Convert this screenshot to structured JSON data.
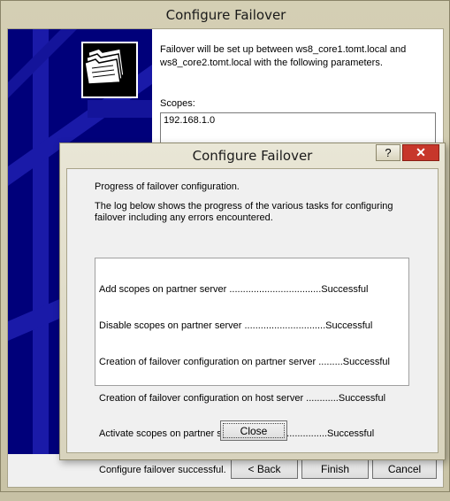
{
  "wizard": {
    "title": "Configure Failover",
    "description": "Failover will be set up between ws8_core1.tomt.local and ws8_core2.tomt.local with the following parameters.",
    "scopes_label": "Scopes:",
    "scopes": [
      "192.168.1.0"
    ],
    "buttons": {
      "back": "< Back",
      "finish": "Finish",
      "cancel": "Cancel"
    },
    "icon": "folders-icon"
  },
  "dialog": {
    "title": "Configure Failover",
    "help_glyph": "?",
    "close_glyph": "✕",
    "heading": "Progress of failover configuration.",
    "log_description": "The log below shows the progress of the various tasks for configuring failover including any errors encountered.",
    "log_lines": [
      "Add scopes on partner server ..................................Successful",
      "Disable scopes on partner server ..............................Successful",
      "Creation of failover configuration on partner server .........Successful",
      "Creation of failover configuration on host server ............Successful",
      "Activate scopes on partner server...............................Successful",
      "Configure failover successful."
    ],
    "close_button": "Close"
  },
  "colors": {
    "wizard_art_bg": "#00007a",
    "chrome": "#d4cfb4",
    "close_red": "#c7372b"
  }
}
